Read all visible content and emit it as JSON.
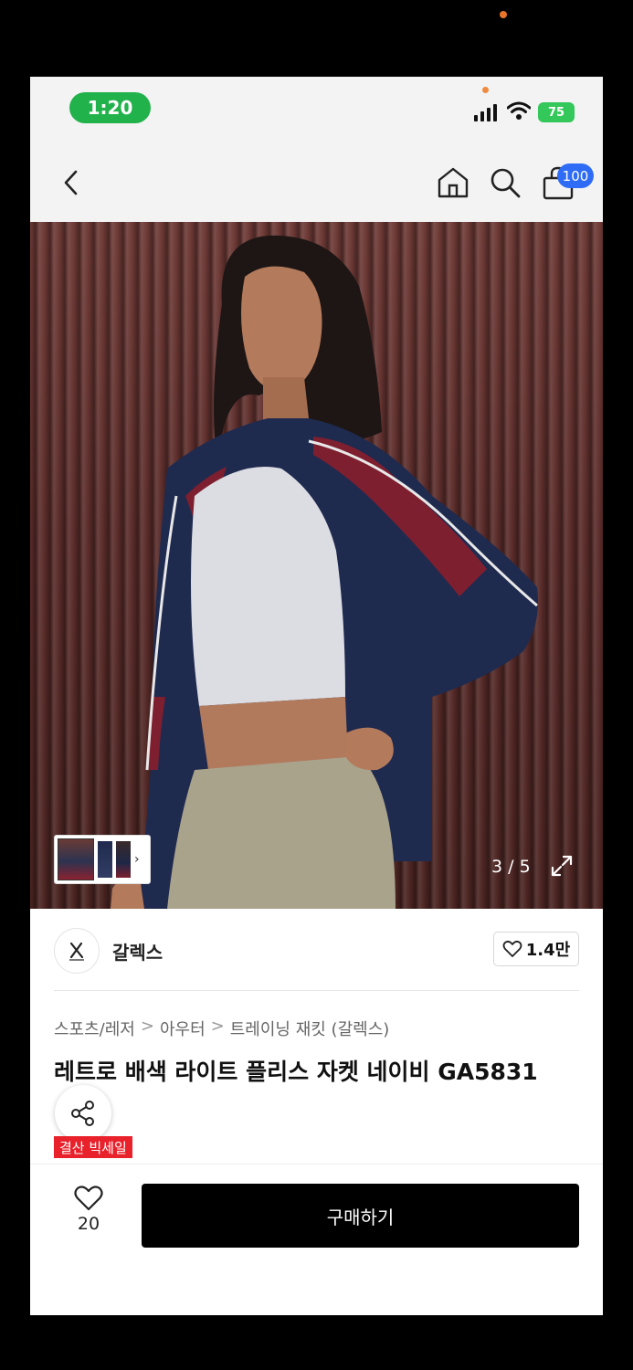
{
  "status_bar": {
    "time": "1:20",
    "battery": "75"
  },
  "nav": {
    "back_icon": "chevron-left-icon",
    "home_icon": "home-icon",
    "search_icon": "search-icon",
    "cart_icon": "shopping-bag-icon",
    "cart_count": "100"
  },
  "gallery": {
    "counter": "3 / 5",
    "expand_icon": "expand-icon"
  },
  "seller": {
    "name": "갈렉스",
    "likes": "1.4만"
  },
  "breadcrumb": [
    "스포츠/레저",
    "아우터",
    "트레이닝 재킷 (갈렉스)"
  ],
  "product": {
    "title": "레트로 배색 라이트 플리스 자켓 네이비 GA5831",
    "badge": "결산 빅세일"
  },
  "bottom": {
    "wish_count": "20",
    "buy_label": "구매하기"
  },
  "colors": {
    "time_pill": "#22b24c",
    "cart_badge": "#2f6cf6",
    "sale_badge": "#e8212b",
    "buy_button": "#000000"
  }
}
